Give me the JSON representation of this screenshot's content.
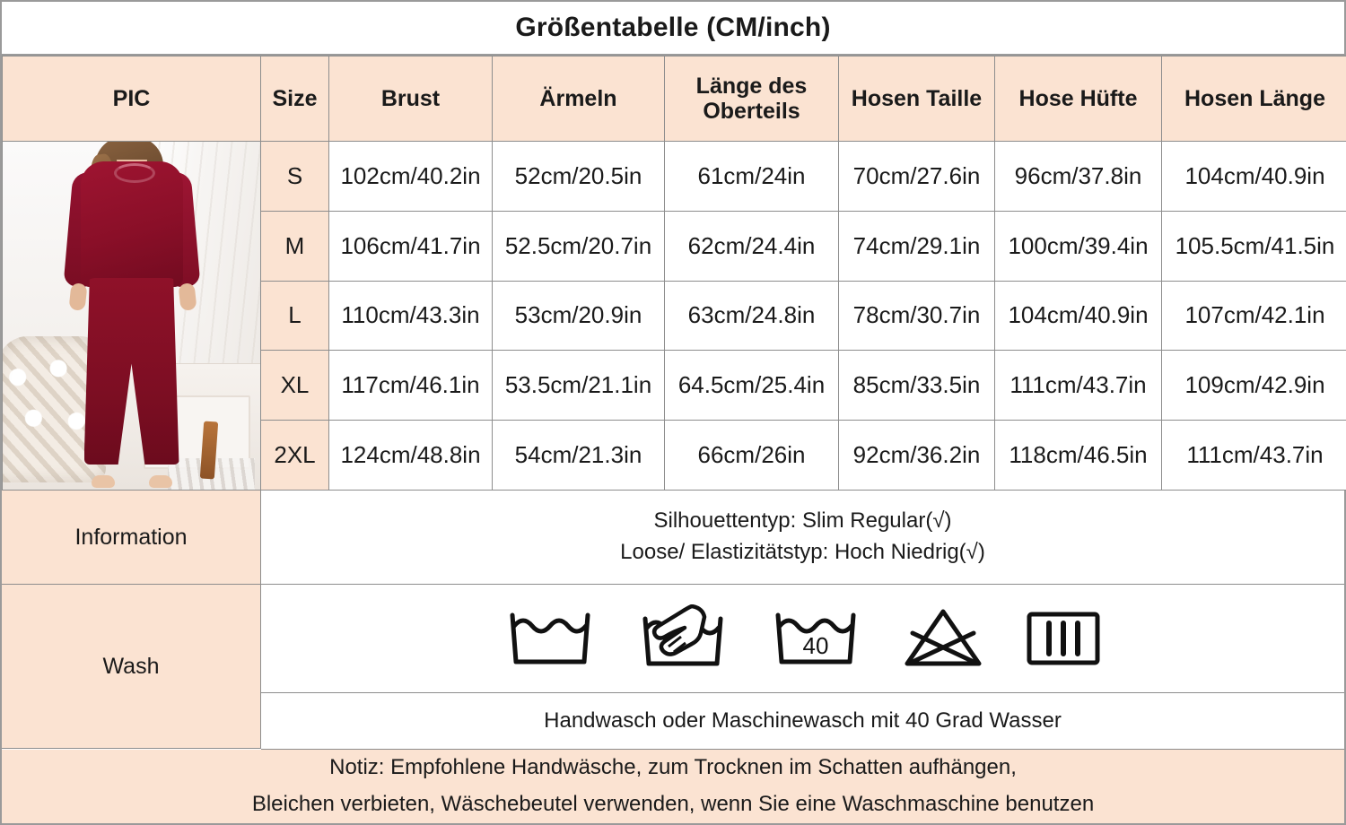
{
  "title": "Größentabelle (CM/inch)",
  "table": {
    "headers": [
      "PIC",
      "Size",
      "Brust",
      "Ärmeln",
      "Länge des Oberteils",
      "Hosen Taille",
      "Hose Hüfte",
      "Hosen Länge"
    ],
    "header_lange_line1": "Länge des",
    "header_lange_line2": "Oberteils",
    "rows": [
      {
        "size": "S",
        "brust": "102cm/40.2in",
        "armeln": "52cm/20.5in",
        "laenge_oberteil": "61cm/24in",
        "hosen_taille": "70cm/27.6in",
        "hose_huefte": "96cm/37.8in",
        "hosen_laenge": "104cm/40.9in"
      },
      {
        "size": "M",
        "brust": "106cm/41.7in",
        "armeln": "52.5cm/20.7in",
        "laenge_oberteil": "62cm/24.4in",
        "hosen_taille": "74cm/29.1in",
        "hose_huefte": "100cm/39.4in",
        "hosen_laenge": "105.5cm/41.5in"
      },
      {
        "size": "L",
        "brust": "110cm/43.3in",
        "armeln": "53cm/20.9in",
        "laenge_oberteil": "63cm/24.8in",
        "hosen_taille": "78cm/30.7in",
        "hose_huefte": "104cm/40.9in",
        "hosen_laenge": "107cm/42.1in"
      },
      {
        "size": "XL",
        "brust": "117cm/46.1in",
        "armeln": "53.5cm/21.1in",
        "laenge_oberteil": "64.5cm/25.4in",
        "hosen_taille": "85cm/33.5in",
        "hose_huefte": "111cm/43.7in",
        "hosen_laenge": "109cm/42.9in"
      },
      {
        "size": "2XL",
        "brust": "124cm/48.8in",
        "armeln": "54cm/21.3in",
        "laenge_oberteil": "66cm/26in",
        "hosen_taille": "92cm/36.2in",
        "hose_huefte": "118cm/46.5in",
        "hosen_laenge": "111cm/43.7in"
      }
    ]
  },
  "information": {
    "label": "Information",
    "line1": "Silhouettentyp: Slim  Regular(√)",
    "line2": "Loose/ Elastizitätstyp: Hoch  Niedrig(√)"
  },
  "wash": {
    "label": "Wash",
    "icon_names": [
      "machine-wash-icon",
      "hand-wash-icon",
      "wash-40-degrees-icon",
      "do-not-bleach-icon",
      "drip-dry-in-shade-icon"
    ],
    "temperature_label": "40",
    "text": "Handwasch oder Maschinewasch mit 40 Grad Wasser"
  },
  "note": {
    "line1": "Notiz: Empfohlene Handwäsche, zum Trocknen im Schatten aufhängen,",
    "line2": "Bleichen verbieten, Wäschebeutel verwenden, wenn Sie eine Waschmaschine benutzen"
  },
  "colors": {
    "header_bg": "#FBE3D2",
    "border": "#8D8D8D",
    "text": "#1A1A1A",
    "garment": "#8A0F28"
  }
}
